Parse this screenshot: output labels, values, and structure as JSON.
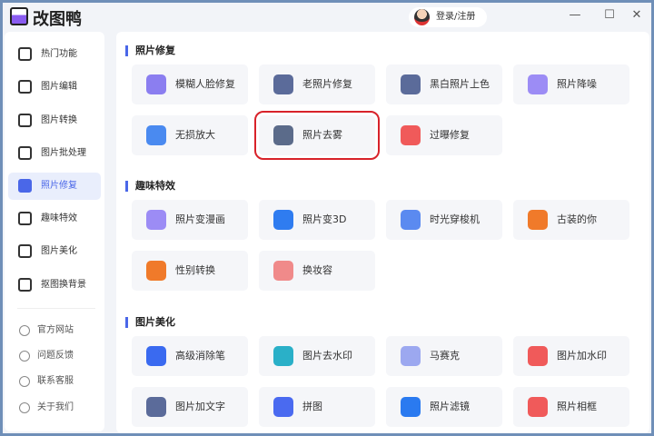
{
  "app": {
    "title": "改图鸭",
    "login": "登录/注册",
    "controls": [
      "—",
      "☐",
      "✕"
    ]
  },
  "sidebar": {
    "items": [
      {
        "label": "热门功能"
      },
      {
        "label": "图片编辑"
      },
      {
        "label": "图片转换"
      },
      {
        "label": "图片批处理"
      },
      {
        "label": "照片修复",
        "active": true
      },
      {
        "label": "趣味特效"
      },
      {
        "label": "图片美化"
      },
      {
        "label": "抠图换背景"
      }
    ],
    "bottom": [
      {
        "label": "官方网站"
      },
      {
        "label": "问题反馈"
      },
      {
        "label": "联系客服"
      },
      {
        "label": "关于我们"
      }
    ]
  },
  "sections": [
    {
      "title": "照片修复",
      "cards": [
        {
          "label": "模糊人脸修复",
          "color": "#8b7ef0"
        },
        {
          "label": "老照片修复",
          "color": "#5b6b9a"
        },
        {
          "label": "黑白照片上色",
          "color": "#5b6b9a"
        },
        {
          "label": "照片降噪",
          "color": "#9c8cf5"
        },
        {
          "label": "无损放大",
          "color": "#4a8af0"
        },
        {
          "label": "照片去雾",
          "color": "#5b6b8a",
          "selected": true
        },
        {
          "label": "过曝修复",
          "color": "#f05a5a"
        }
      ]
    },
    {
      "title": "趣味特效",
      "cards": [
        {
          "label": "照片变漫画",
          "color": "#9c8cf5"
        },
        {
          "label": "照片变3D",
          "color": "#2f7cf0"
        },
        {
          "label": "时光穿梭机",
          "color": "#5b8af0"
        },
        {
          "label": "古装的你",
          "color": "#f07a2a"
        },
        {
          "label": "性别转换",
          "color": "#f07a2a"
        },
        {
          "label": "换妆容",
          "color": "#f08a8a"
        }
      ]
    },
    {
      "title": "图片美化",
      "cards": [
        {
          "label": "高级消除笔",
          "color": "#3a6af0"
        },
        {
          "label": "图片去水印",
          "color": "#2ab0c8"
        },
        {
          "label": "马赛克",
          "color": "#9ca8f0"
        },
        {
          "label": "图片加水印",
          "color": "#f05a5a"
        },
        {
          "label": "图片加文字",
          "color": "#5b6b9a"
        },
        {
          "label": "拼图",
          "color": "#4a6af0"
        },
        {
          "label": "照片滤镜",
          "color": "#2a7af0"
        },
        {
          "label": "照片相框",
          "color": "#f05a5a"
        }
      ]
    }
  ]
}
